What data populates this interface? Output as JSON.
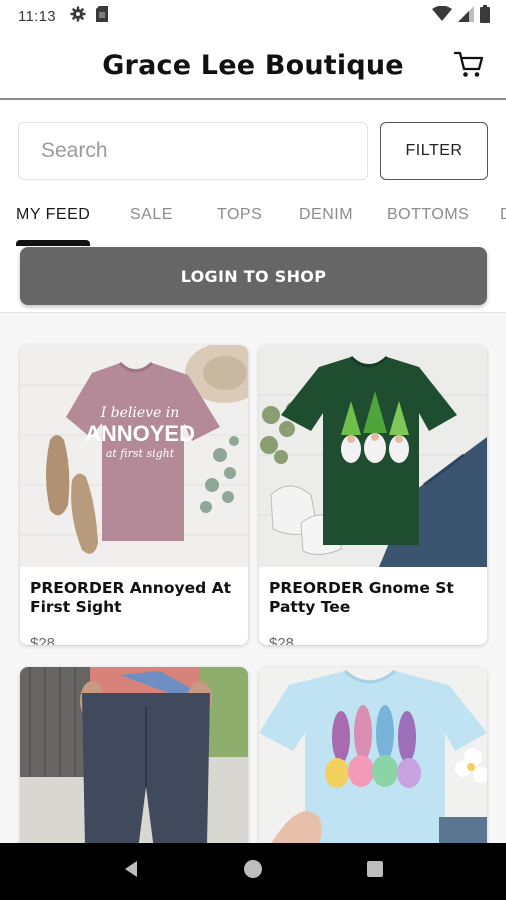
{
  "status_bar": {
    "time": "11:13",
    "icons_left": [
      "gear-icon",
      "sim-card-icon"
    ],
    "icons_right": [
      "wifi-icon",
      "signal-icon",
      "battery-icon"
    ]
  },
  "header": {
    "title": "Grace Lee Boutique",
    "cart_icon": "cart-icon"
  },
  "search": {
    "placeholder": "Search",
    "value": ""
  },
  "filter": {
    "label": "FILTER"
  },
  "tabs": [
    {
      "label": "MY FEED",
      "active": true
    },
    {
      "label": "SALE",
      "active": false
    },
    {
      "label": "TOPS",
      "active": false
    },
    {
      "label": "DENIM",
      "active": false
    },
    {
      "label": "BOTTOMS",
      "active": false
    },
    {
      "label": "D",
      "active": false
    }
  ],
  "login": {
    "label": "LOGIN TO SHOP"
  },
  "products": [
    {
      "name": "PREORDER Annoyed At First Sight",
      "price": "$28",
      "shirt_color": "#b48a98",
      "shirt_text_line1": "I believe in",
      "shirt_text_line2": "ANNOYED",
      "shirt_text_line3": "at first sight"
    },
    {
      "name": "PREORDER Gnome St Patty Tee",
      "price": "$28",
      "shirt_color": "#1f4d30"
    },
    {
      "name": "",
      "price": ""
    },
    {
      "name": "",
      "price": ""
    }
  ],
  "nav": {
    "back_icon": "back-triangle-icon",
    "home_icon": "home-circle-icon",
    "recents_icon": "recents-square-icon"
  },
  "colors": {
    "login_button": "#666666",
    "nav_bar": "#000000",
    "active_tab": "#1a1a1a",
    "inactive_tab": "#8c8c8c"
  }
}
